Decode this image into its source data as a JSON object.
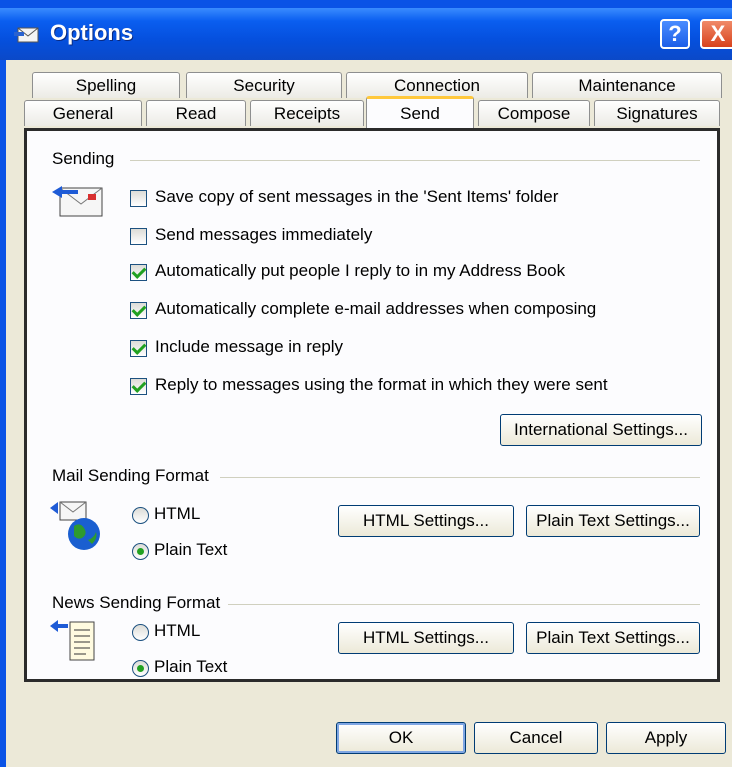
{
  "window": {
    "title": "Options",
    "help_label": "?",
    "close_label": "X"
  },
  "tabs_row1": [
    "Spelling",
    "Security",
    "Connection",
    "Maintenance"
  ],
  "tabs_row2": [
    "General",
    "Read",
    "Receipts",
    "Send",
    "Compose",
    "Signatures"
  ],
  "active_tab": "Send",
  "sending": {
    "title": "Sending",
    "options": [
      {
        "label": "Save copy of sent messages in the 'Sent Items' folder",
        "checked": false
      },
      {
        "label": "Send messages immediately",
        "checked": false
      },
      {
        "label": "Automatically put people I reply to in my Address Book",
        "checked": true
      },
      {
        "label": "Automatically complete e-mail addresses when composing",
        "checked": true
      },
      {
        "label": "Include message in reply",
        "checked": true
      },
      {
        "label": "Reply to messages using the format in which they were sent",
        "checked": true
      }
    ],
    "intl_button": "International Settings..."
  },
  "mail_format": {
    "title": "Mail Sending Format",
    "html_label": "HTML",
    "plain_label": "Plain Text",
    "selected": "Plain Text",
    "html_settings": "HTML Settings...",
    "plain_settings": "Plain Text Settings..."
  },
  "news_format": {
    "title": "News Sending Format",
    "html_label": "HTML",
    "plain_label": "Plain Text",
    "selected": "Plain Text",
    "html_settings": "HTML Settings...",
    "plain_settings": "Plain Text Settings..."
  },
  "footer": {
    "ok": "OK",
    "cancel": "Cancel",
    "apply": "Apply"
  }
}
